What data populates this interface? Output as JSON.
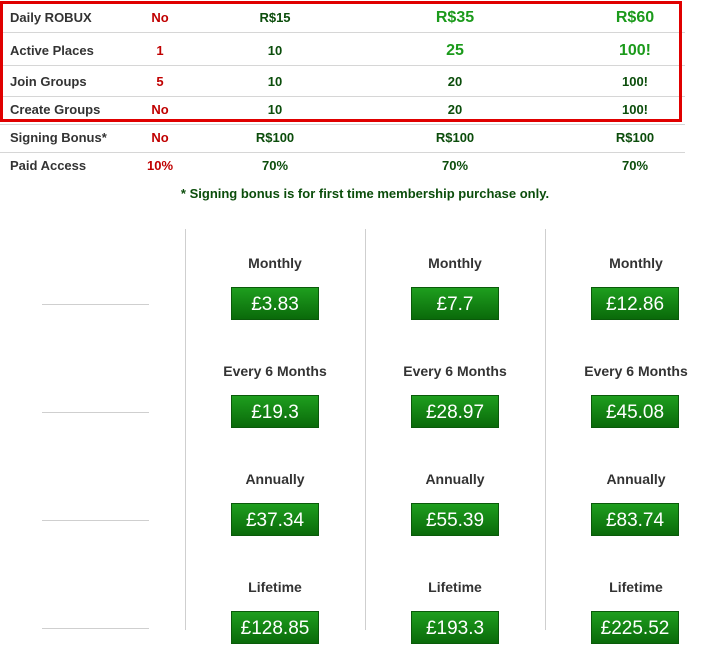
{
  "table": {
    "rows": [
      {
        "label": "Daily ROBUX",
        "c0": "No",
        "c1": "R$15",
        "c2": "R$35",
        "c3": "R$60"
      },
      {
        "label": "Active Places",
        "c0": "1",
        "c1": "10",
        "c2": "25",
        "c3": "100!"
      },
      {
        "label": "Join Groups",
        "c0": "5",
        "c1": "10",
        "c2": "20",
        "c3": "100!"
      },
      {
        "label": "Create Groups",
        "c0": "No",
        "c1": "10",
        "c2": "20",
        "c3": "100!"
      },
      {
        "label": "Signing Bonus*",
        "c0": "No",
        "c1": "R$100",
        "c2": "R$100",
        "c3": "R$100"
      },
      {
        "label": "Paid Access",
        "c0": "10%",
        "c1": "70%",
        "c2": "70%",
        "c3": "70%"
      }
    ]
  },
  "footnote": "* Signing bonus is for first time membership purchase only.",
  "plans": [
    {
      "monthly_label": "Monthly",
      "monthly_price": "£3.83",
      "six_label": "Every 6 Months",
      "six_price": "£19.3",
      "annual_label": "Annually",
      "annual_price": "£37.34",
      "lifetime_label": "Lifetime",
      "lifetime_price": "£128.85"
    },
    {
      "monthly_label": "Monthly",
      "monthly_price": "£7.7",
      "six_label": "Every 6 Months",
      "six_price": "£28.97",
      "annual_label": "Annually",
      "annual_price": "£55.39",
      "lifetime_label": "Lifetime",
      "lifetime_price": "£193.3"
    },
    {
      "monthly_label": "Monthly",
      "monthly_price": "£12.86",
      "six_label": "Every 6 Months",
      "six_price": "£45.08",
      "annual_label": "Annually",
      "annual_price": "£83.74",
      "lifetime_label": "Lifetime",
      "lifetime_price": "£225.52"
    }
  ],
  "colors": {
    "accent_green": "#1b9a1b",
    "dark_green": "#0b4d0b",
    "red": "#c00000",
    "highlight_border": "#e00000"
  }
}
